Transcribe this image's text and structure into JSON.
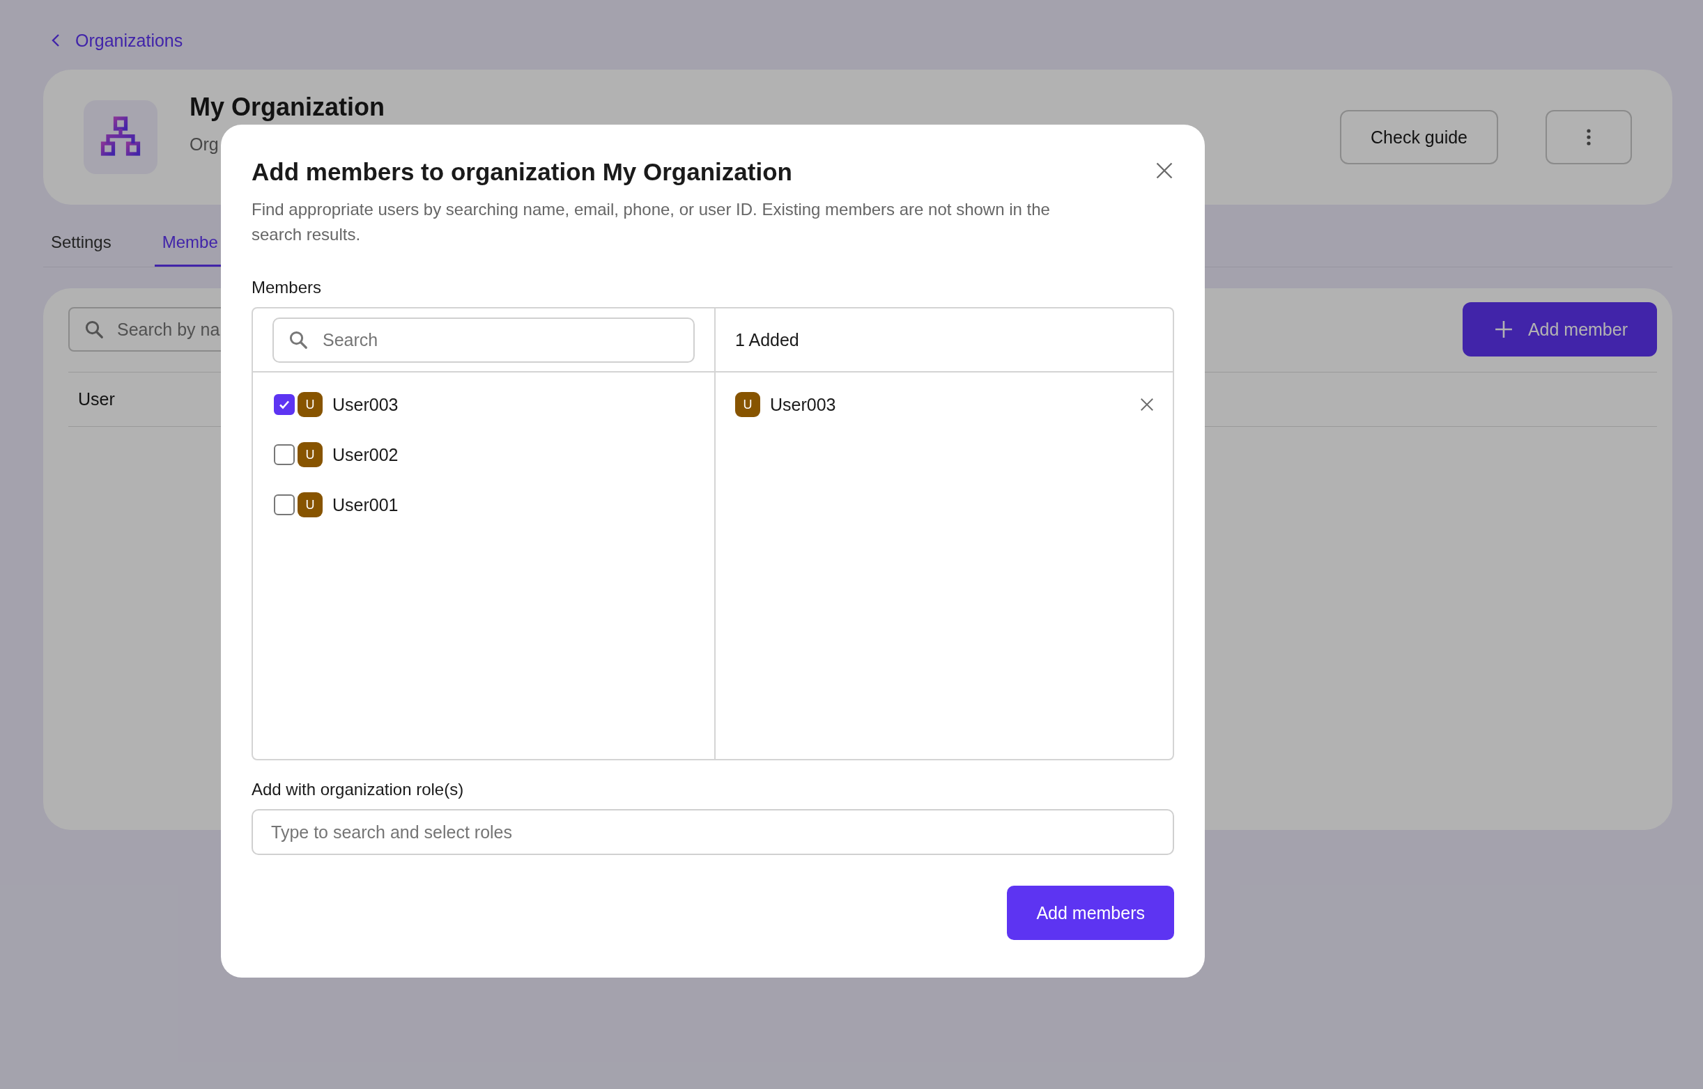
{
  "breadcrumb": {
    "label": "Organizations"
  },
  "header": {
    "title": "My Organization",
    "subtitle": "Org",
    "guide_button": "Check guide"
  },
  "tabs": [
    {
      "label": "Settings",
      "selected": false
    },
    {
      "label": "Membe",
      "selected": true
    }
  ],
  "members_panel": {
    "search": {
      "placeholder": "Search by na"
    },
    "add_button": "Add member",
    "columns": [
      "User"
    ]
  },
  "dialog": {
    "title": "Add members to organization My Organization",
    "description": "Find appropriate users by searching name, email, phone, or user ID. Existing members are not shown in the search results.",
    "members_label": "Members",
    "search": {
      "placeholder": "Search"
    },
    "candidates": [
      {
        "name": "User003",
        "initial": "U",
        "checked": true
      },
      {
        "name": "User002",
        "initial": "U",
        "checked": false
      },
      {
        "name": "User001",
        "initial": "U",
        "checked": false
      }
    ],
    "added_label": "1 Added",
    "added": [
      {
        "name": "User003",
        "initial": "U"
      }
    ],
    "roles_label": "Add with organization role(s)",
    "roles": {
      "placeholder": "Type to search and select roles"
    },
    "submit": "Add members"
  }
}
